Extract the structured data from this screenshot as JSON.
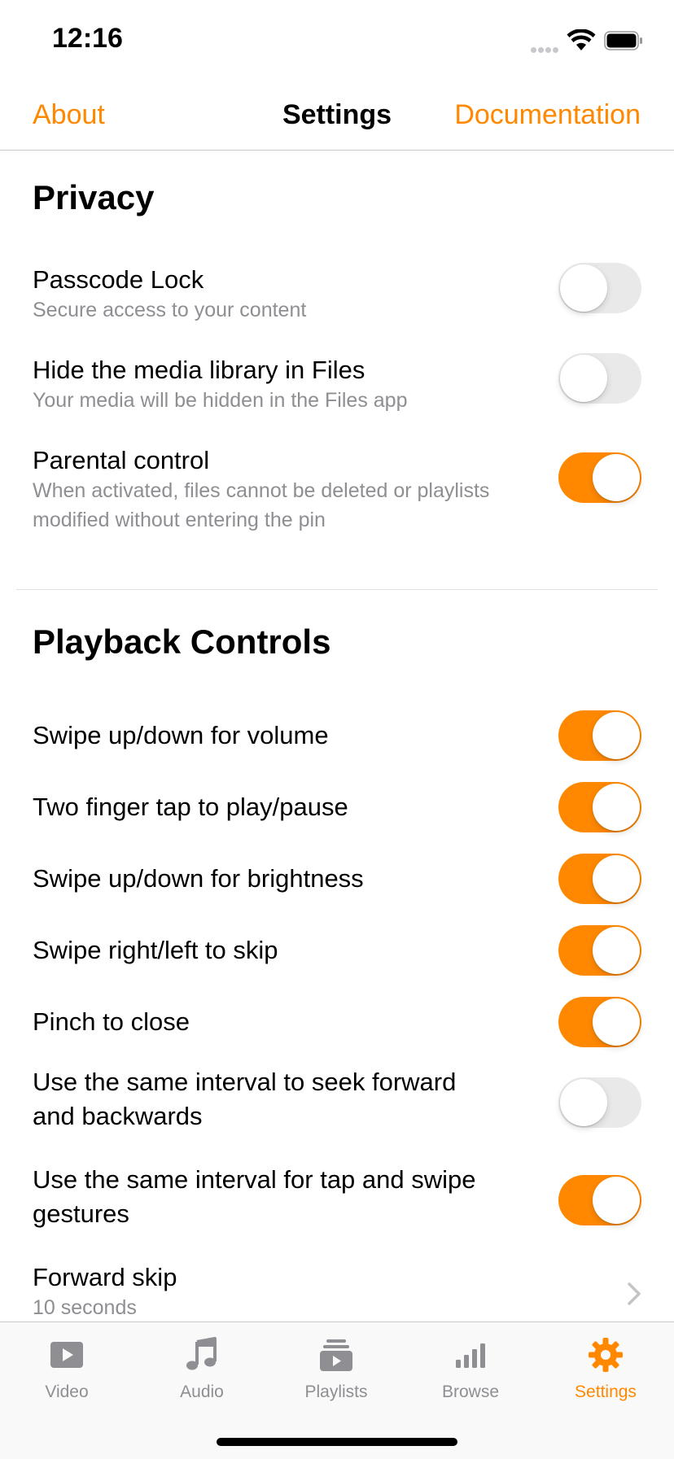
{
  "status_bar": {
    "time": "12:16"
  },
  "nav": {
    "left": "About",
    "title": "Settings",
    "right": "Documentation"
  },
  "sections": {
    "privacy": {
      "title": "Privacy",
      "items": [
        {
          "title": "Passcode Lock",
          "subtitle": "Secure access to your content",
          "on": false
        },
        {
          "title": "Hide the media library in Files",
          "subtitle": "Your media will be hidden in the Files app",
          "on": false
        },
        {
          "title": "Parental control",
          "subtitle": "When activated, files cannot be deleted or playlists modified without entering the pin",
          "on": true
        }
      ]
    },
    "playback": {
      "title": "Playback Controls",
      "items": [
        {
          "title": "Swipe up/down for volume",
          "on": true
        },
        {
          "title": "Two finger tap to play/pause",
          "on": true
        },
        {
          "title": "Swipe up/down for brightness",
          "on": true
        },
        {
          "title": "Swipe right/left to skip",
          "on": true
        },
        {
          "title": "Pinch to close",
          "on": true
        },
        {
          "title": "Use the same interval to seek forward and backwards",
          "on": false
        },
        {
          "title": "Use the same interval for tap and swipe gestures",
          "on": true
        },
        {
          "title": "Forward skip",
          "subtitle": "10 seconds"
        }
      ]
    }
  },
  "tabs": [
    {
      "label": "Video",
      "icon": "video-icon"
    },
    {
      "label": "Audio",
      "icon": "music-note-icon"
    },
    {
      "label": "Playlists",
      "icon": "playlists-icon"
    },
    {
      "label": "Browse",
      "icon": "browse-icon"
    },
    {
      "label": "Settings",
      "icon": "gear-icon",
      "active": true
    }
  ],
  "colors": {
    "accent": "#ff8800",
    "toggle_off": "#e9e9ea",
    "secondary_text": "#8e8e93"
  }
}
